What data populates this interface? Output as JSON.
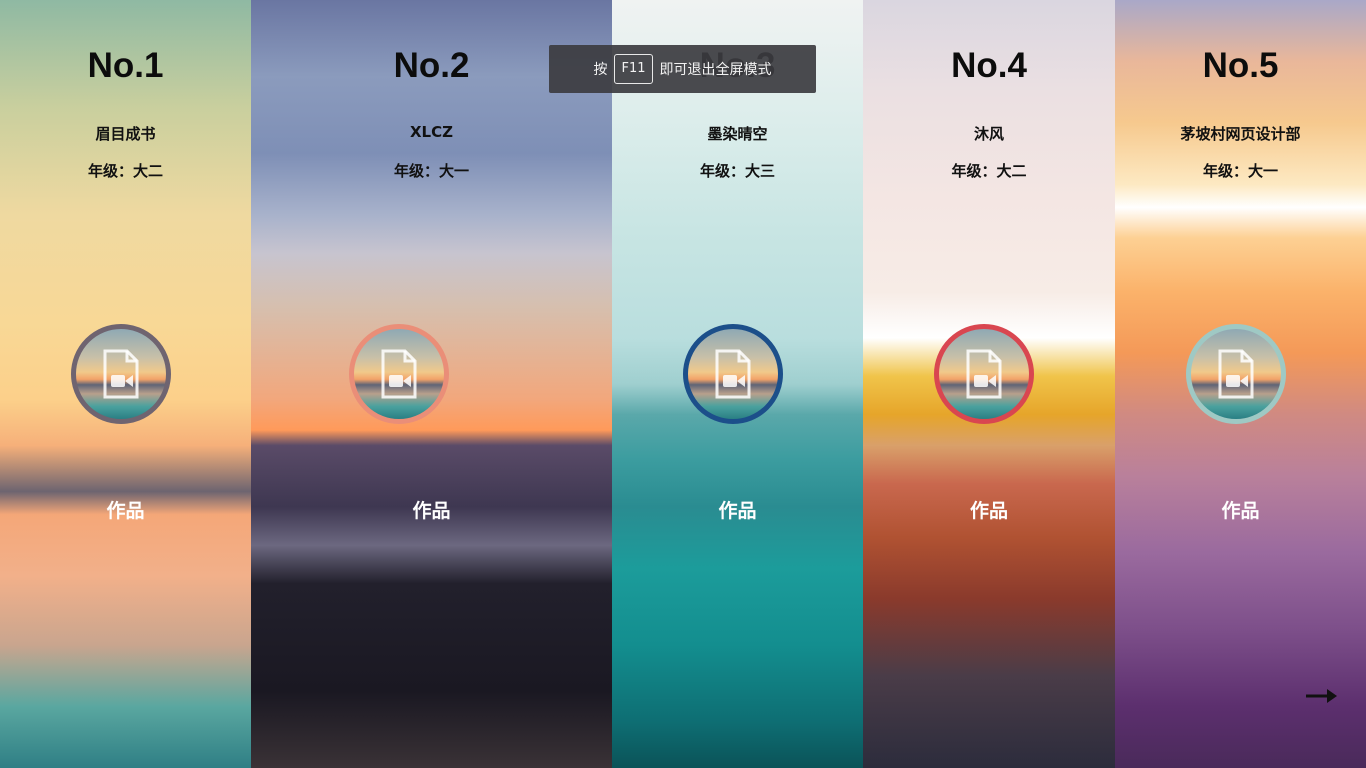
{
  "toast": {
    "prefix": "按",
    "key": "F11",
    "suffix": "即可退出全屏模式"
  },
  "members": [
    {
      "rank": "No.1",
      "name": "眉目成书",
      "grade": "年级：大二",
      "work_label": "作品",
      "ring_color": "#6f6470"
    },
    {
      "rank": "No.2",
      "name": "XLCZ",
      "grade": "年级：大一",
      "work_label": "作品",
      "ring_color": "#ea8e78"
    },
    {
      "rank": "No.3",
      "name": "墨染晴空",
      "grade": "年级：大三",
      "work_label": "作品",
      "ring_color": "#1c4f8a"
    },
    {
      "rank": "No.4",
      "name": "沐风",
      "grade": "年级：大二",
      "work_label": "作品",
      "ring_color": "#d94650"
    },
    {
      "rank": "No.5",
      "name": "茅坡村网页设计部",
      "grade": "年级：大一",
      "work_label": "作品",
      "ring_color": "#9fc9c4"
    }
  ],
  "icons": {
    "avatar": "video-file-icon",
    "next": "arrow-right-icon"
  }
}
